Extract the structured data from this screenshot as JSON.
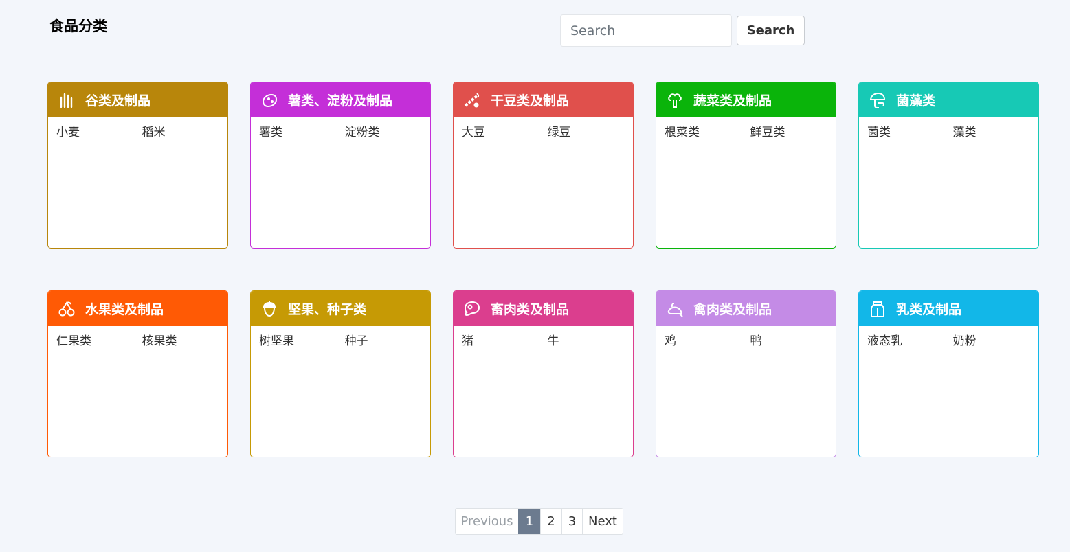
{
  "page_title": "食品分类",
  "search": {
    "placeholder": "Search",
    "value": "",
    "button_label": "Search"
  },
  "categories": [
    {
      "title": "谷类及制品",
      "icon": "grain-icon",
      "color": "#b8860b",
      "items": [
        "小麦",
        "稻米"
      ]
    },
    {
      "title": "薯类、淀粉及制品",
      "icon": "potato-icon",
      "color": "#c42fd8",
      "items": [
        "薯类",
        "淀粉类"
      ]
    },
    {
      "title": "干豆类及制品",
      "icon": "bean-icon",
      "color": "#e0504c",
      "items": [
        "大豆",
        "绿豆"
      ]
    },
    {
      "title": "蔬菜类及制品",
      "icon": "broccoli-icon",
      "color": "#0ab40a",
      "items": [
        "根菜类",
        "鲜豆类"
      ]
    },
    {
      "title": "菌藻类",
      "icon": "mushroom-icon",
      "color": "#17c9b5",
      "items": [
        "菌类",
        "藻类"
      ]
    },
    {
      "title": "水果类及制品",
      "icon": "cherry-icon",
      "color": "#ff5a05",
      "items": [
        "仁果类",
        "核果类"
      ]
    },
    {
      "title": "坚果、种子类",
      "icon": "acorn-icon",
      "color": "#c69a05",
      "items": [
        "树坚果",
        "种子"
      ]
    },
    {
      "title": "畜肉类及制品",
      "icon": "meat-icon",
      "color": "#db3e8e",
      "items": [
        "猪",
        "牛"
      ]
    },
    {
      "title": "禽肉类及制品",
      "icon": "poultry-icon",
      "color": "#c48be6",
      "items": [
        "鸡",
        "鸭"
      ]
    },
    {
      "title": "乳类及制品",
      "icon": "milk-carton-icon",
      "color": "#12b7e8",
      "items": [
        "液态乳",
        "奶粉"
      ]
    }
  ],
  "pagination": {
    "previous_label": "Previous",
    "next_label": "Next",
    "pages": [
      "1",
      "2",
      "3"
    ],
    "current_page": "1"
  },
  "colors": {
    "page_background": "#f3f6fb",
    "active_page": "#6c7b8f"
  }
}
